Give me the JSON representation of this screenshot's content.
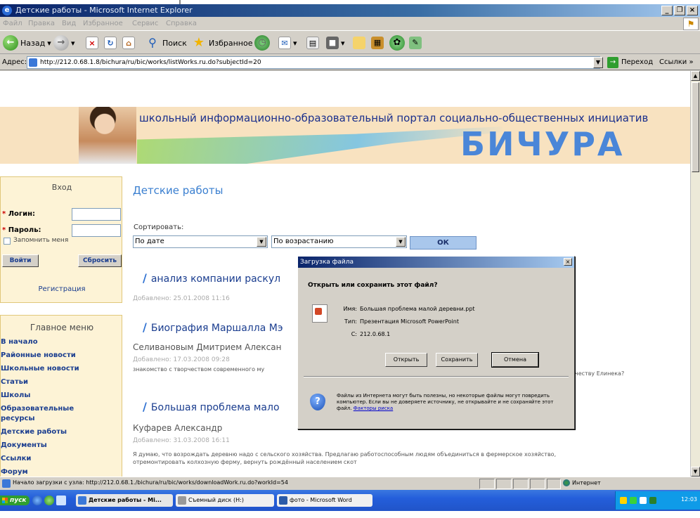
{
  "window": {
    "title": "Детские работы - Microsoft Internet Explorer",
    "buttons": [
      "_",
      "❐",
      "×"
    ]
  },
  "menubar": [
    "Файл",
    "Правка",
    "Вид",
    "Избранное",
    "Сервис",
    "Справка"
  ],
  "toolbar": {
    "back": "Назад",
    "search": "Поиск",
    "favorites": "Избранное"
  },
  "address": {
    "label": "Адрес:",
    "url": "http://212.0.68.1.8/bichura/ru/bic/works/listWorks.ru.do?subjectId=20",
    "go": "Переход",
    "links": "Ссылки »"
  },
  "banner": {
    "tagline": "школьный информационно-образовательный портал социально-общественных инициатив",
    "brand": "БИЧУРА"
  },
  "login": {
    "header": "Вход",
    "login_label": "Логин:",
    "password_label": "Пароль:",
    "remember": "Запомнить меня",
    "submit": "Войти",
    "reset": "Сбросить",
    "register": "Регистрация"
  },
  "menu": {
    "header": "Главное меню",
    "items": [
      "В начало",
      "Районные новости",
      "Школьные новости",
      "Статьи",
      "Школы",
      "Образовательные",
      "ресурсы",
      "Детские работы",
      "Документы",
      "Ссылки",
      "Форум"
    ]
  },
  "main": {
    "title": "Детские работы",
    "sort_label": "Сортировать:",
    "sort_by": "По дате",
    "sort_order": "По возрастанию",
    "ok": "ОК"
  },
  "articles": [
    {
      "title": "анализ компании раскул",
      "meta": "Добавлено: 25.01.2008 11:16"
    },
    {
      "title": "Биография Маршалла Мэ",
      "author": "Селивановым Дмитрием Алексан",
      "meta": "Добавлено: 17.03.2008 09:28",
      "desc_left": "знакомство с творчеством современного му",
      "desc_right": "честву Елинека?"
    },
    {
      "title": "Большая проблема мало",
      "author": "Куфарев Александр",
      "meta": "Добавлено: 31.03.2008 16:11",
      "desc_line1": "Я думаю, что возрождать деревню надо с сельского хозяйства. Предлагаю работоспособным людям объединиться в фермерское хозяйство,",
      "desc_line2": "отремонтировать колхозную ферму, вернуть рождённый населением скот"
    }
  ],
  "dialog": {
    "title": "Загрузка файла",
    "close": "×",
    "question": "Открыть или сохранить этот файл?",
    "name_key": "Имя:",
    "name_val": "Большая проблема малой деревни.ppt",
    "type_key": "Тип:",
    "type_val": "Презентация Microsoft PowerPoint",
    "from_key": "С:",
    "from_val": "212.0.68.1",
    "open": "Открыть",
    "save": "Сохранить",
    "cancel": "Отмена",
    "warning": "Файлы из Интернета могут быть полезны, но некоторые файлы могут повредить компьютер. Если вы не доверяете источнику, не открывайте и не сохраняйте этот файл.",
    "risk_link": "Факторы риска"
  },
  "status": {
    "text": "Начало загрузки с узла: http://212.0.68.1./bichura/ru/bic/works/downloadWork.ru.do?workId=54",
    "zone": "Интернет"
  },
  "taskbar": {
    "start": "пуск",
    "tasks": [
      "Детские работы - Mi...",
      "Съемный диск (H:)",
      "фото - Microsoft Word"
    ],
    "clock": "12:03"
  }
}
